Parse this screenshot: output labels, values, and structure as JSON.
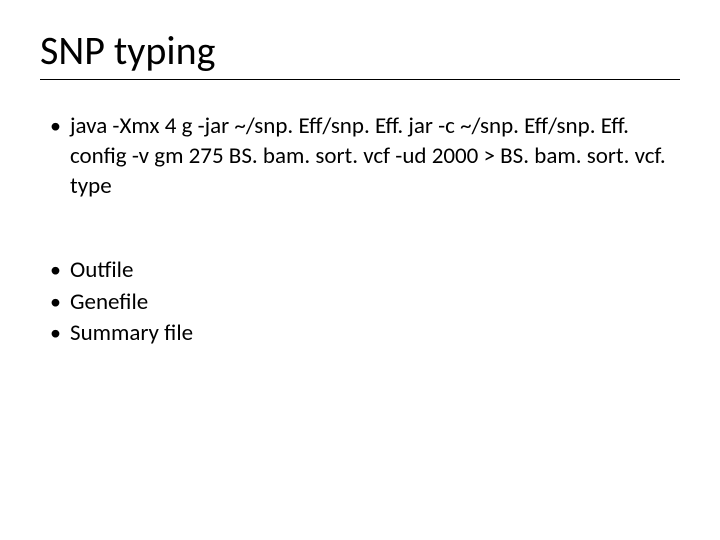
{
  "title": "SNP typing",
  "bullets_group1": [
    "java -Xmx 4 g -jar ~/snp. Eff/snp. Eff. jar -c ~/snp. Eff/snp. Eff. config -v gm 275 BS. bam. sort. vcf -ud 2000 > BS. bam. sort. vcf. type"
  ],
  "bullets_group2": [
    "Outfile",
    "Genefile",
    "Summary file"
  ]
}
